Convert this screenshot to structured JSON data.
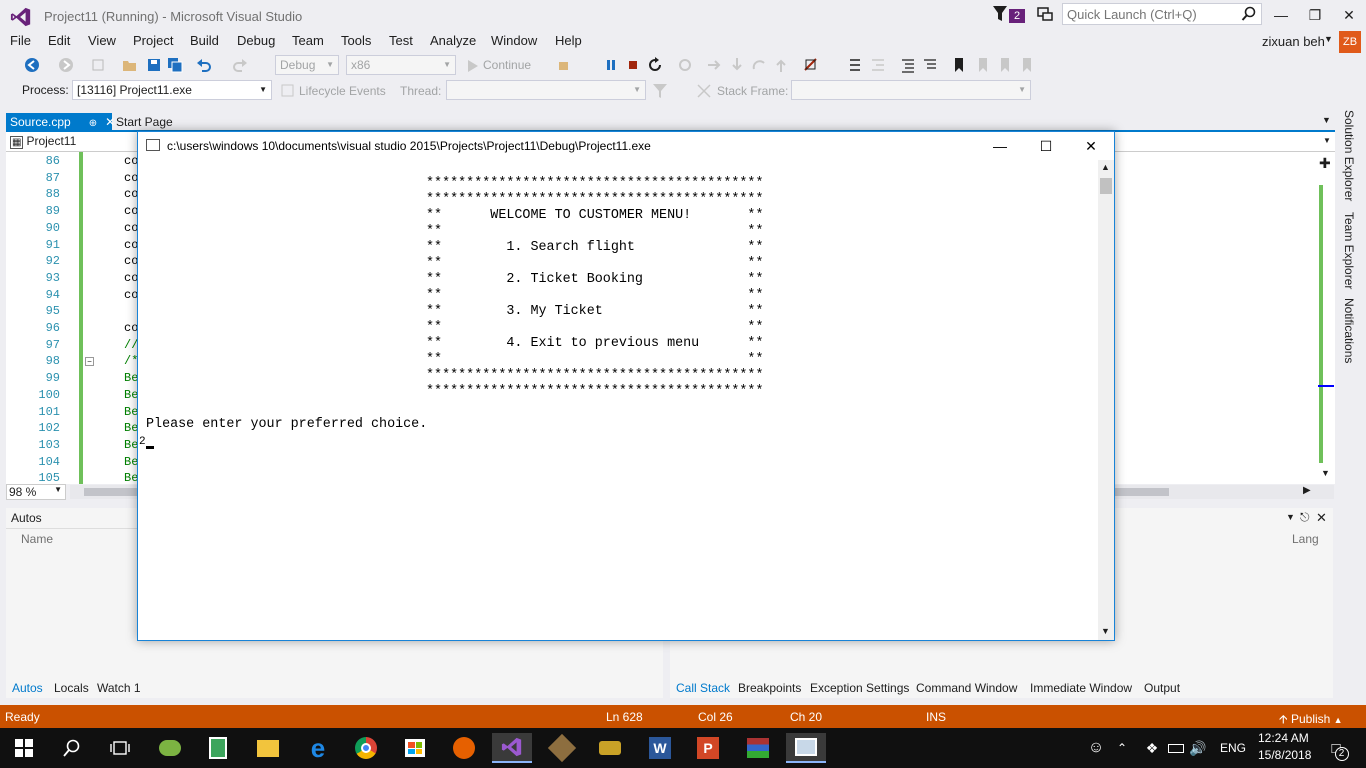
{
  "window": {
    "title": "Project11 (Running) - Microsoft Visual Studio",
    "notification_count": "2",
    "quick_launch_placeholder": "Quick Launch (Ctrl+Q)",
    "user_name": "zixuan beh",
    "user_initials": "ZB"
  },
  "menu": [
    "File",
    "Edit",
    "View",
    "Project",
    "Build",
    "Debug",
    "Team",
    "Tools",
    "Test",
    "Analyze",
    "Window",
    "Help"
  ],
  "toolbar": {
    "config": "Debug",
    "platform": "x86",
    "continue_label": "Continue",
    "process_label": "Process:",
    "process_value": "[13116] Project11.exe",
    "lifecycle_label": "Lifecycle Events",
    "thread_label": "Thread:",
    "stack_frame_label": "Stack Frame:"
  },
  "editor": {
    "tabs": [
      "Source.cpp",
      "Start Page"
    ],
    "nav_project": "Project11",
    "zoom": "98 %",
    "lines": [
      {
        "n": "86",
        "code": "co",
        "green": false
      },
      {
        "n": "87",
        "code": "co",
        "green": false
      },
      {
        "n": "88",
        "code": "co",
        "green": false
      },
      {
        "n": "89",
        "code": "co",
        "green": false
      },
      {
        "n": "90",
        "code": "co",
        "green": false
      },
      {
        "n": "91",
        "code": "co",
        "green": false
      },
      {
        "n": "92",
        "code": "co",
        "green": false
      },
      {
        "n": "93",
        "code": "co",
        "green": false
      },
      {
        "n": "94",
        "code": "co",
        "green": false
      },
      {
        "n": "95",
        "code": "",
        "green": false
      },
      {
        "n": "96",
        "code": "co",
        "green": false
      },
      {
        "n": "97",
        "code": "//",
        "green": true
      },
      {
        "n": "98",
        "code": "/*",
        "green": true
      },
      {
        "n": "99",
        "code": "Be",
        "green": true
      },
      {
        "n": "100",
        "code": "Be",
        "green": true
      },
      {
        "n": "101",
        "code": "Be",
        "green": true
      },
      {
        "n": "102",
        "code": "Be",
        "green": true
      },
      {
        "n": "103",
        "code": "Be",
        "green": true
      },
      {
        "n": "104",
        "code": "Be",
        "green": true
      },
      {
        "n": "105",
        "code": "Be",
        "green": true
      }
    ]
  },
  "side_tabs": [
    "Solution Explorer",
    "Team Explorer",
    "Notifications"
  ],
  "panels": {
    "autos_title": "Autos",
    "autos_col_name": "Name",
    "callstack_col_lang": "Lang",
    "left_tabs": [
      "Autos",
      "Locals",
      "Watch 1"
    ],
    "right_tabs": [
      "Call Stack",
      "Breakpoints",
      "Exception Settings",
      "Command Window",
      "Immediate Window",
      "Output"
    ]
  },
  "status": {
    "ready": "Ready",
    "ln": "Ln 628",
    "col": "Col 26",
    "ch": "Ch 20",
    "ins": "INS",
    "publish": "Publish"
  },
  "taskbar": {
    "lang": "ENG",
    "time": "12:24 AM",
    "date": "15/8/2018",
    "notification_count": "2"
  },
  "console": {
    "title": "c:\\users\\windows 10\\documents\\visual studio 2015\\Projects\\Project11\\Debug\\Project11.exe",
    "menu_lines": [
      "******************************************",
      "******************************************",
      "**      WELCOME TO CUSTOMER MENU!       **",
      "**                                      **",
      "**        1. Search flight              **",
      "**                                      **",
      "**        2. Ticket Booking             **",
      "**                                      **",
      "**        3. My Ticket                  **",
      "**                                      **",
      "**        4. Exit to previous menu      **",
      "**                                      **",
      "******************************************",
      "******************************************"
    ],
    "prompt": "Please enter your preferred choice.",
    "input": "2"
  }
}
